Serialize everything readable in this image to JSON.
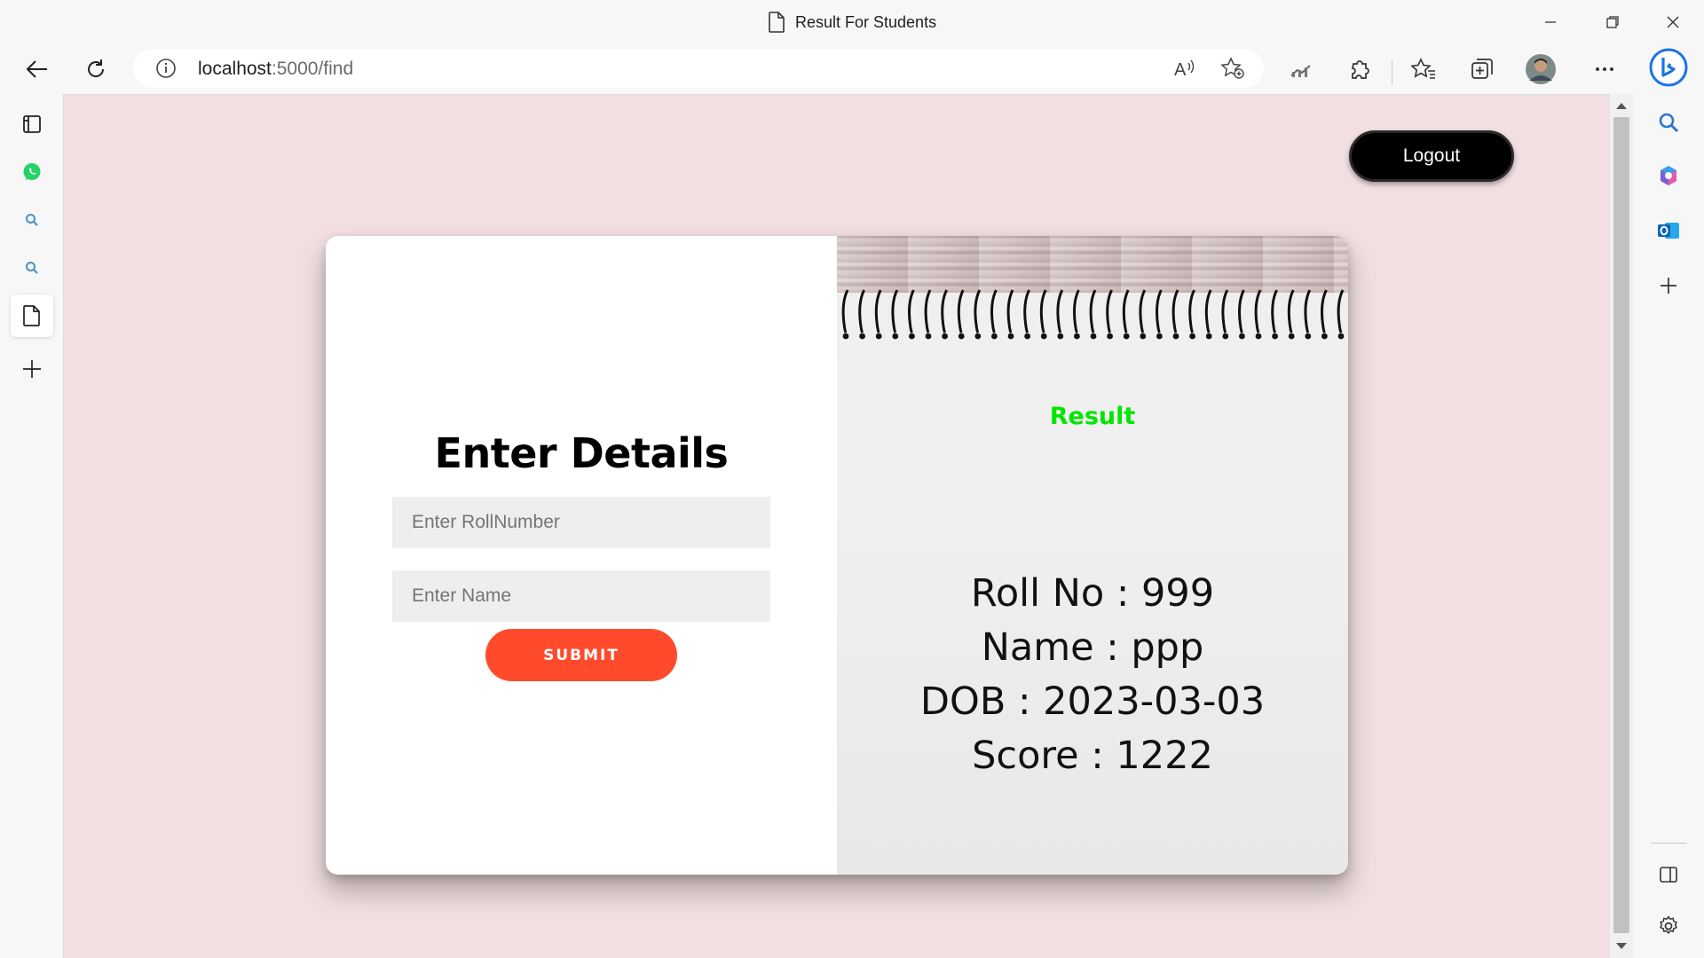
{
  "window": {
    "tab_title": "Result For Students",
    "controls": [
      "minimize",
      "restore",
      "close"
    ]
  },
  "toolbar": {
    "url_host": "localhost",
    "url_rest": ":5000/find",
    "profile": "avatar"
  },
  "left_sidebar": {
    "items": [
      "tabs-icon",
      "whatsapp-icon",
      "search-icon",
      "search-icon",
      "page-icon",
      "add-icon"
    ]
  },
  "right_sidebar": {
    "items": [
      "bing-icon",
      "search-icon",
      "copilot-icon",
      "outlook-icon",
      "add-icon",
      "split-screen-icon",
      "settings-icon"
    ]
  },
  "page": {
    "logout_label": "Logout",
    "form": {
      "heading": "Enter Details",
      "rollnumber_placeholder": "Enter RollNumber",
      "name_placeholder": "Enter Name",
      "submit_label": "SUBMIT"
    },
    "result": {
      "title": "Result",
      "roll": "Roll No : 999",
      "name": "Name : ppp",
      "dob": "DOB : 2023-03-03",
      "score": "Score : 1222"
    },
    "colors": {
      "background": "#f1dfe1",
      "submit": "#ff4b2b",
      "result_title": "#00e600",
      "logout": "#000000"
    }
  }
}
